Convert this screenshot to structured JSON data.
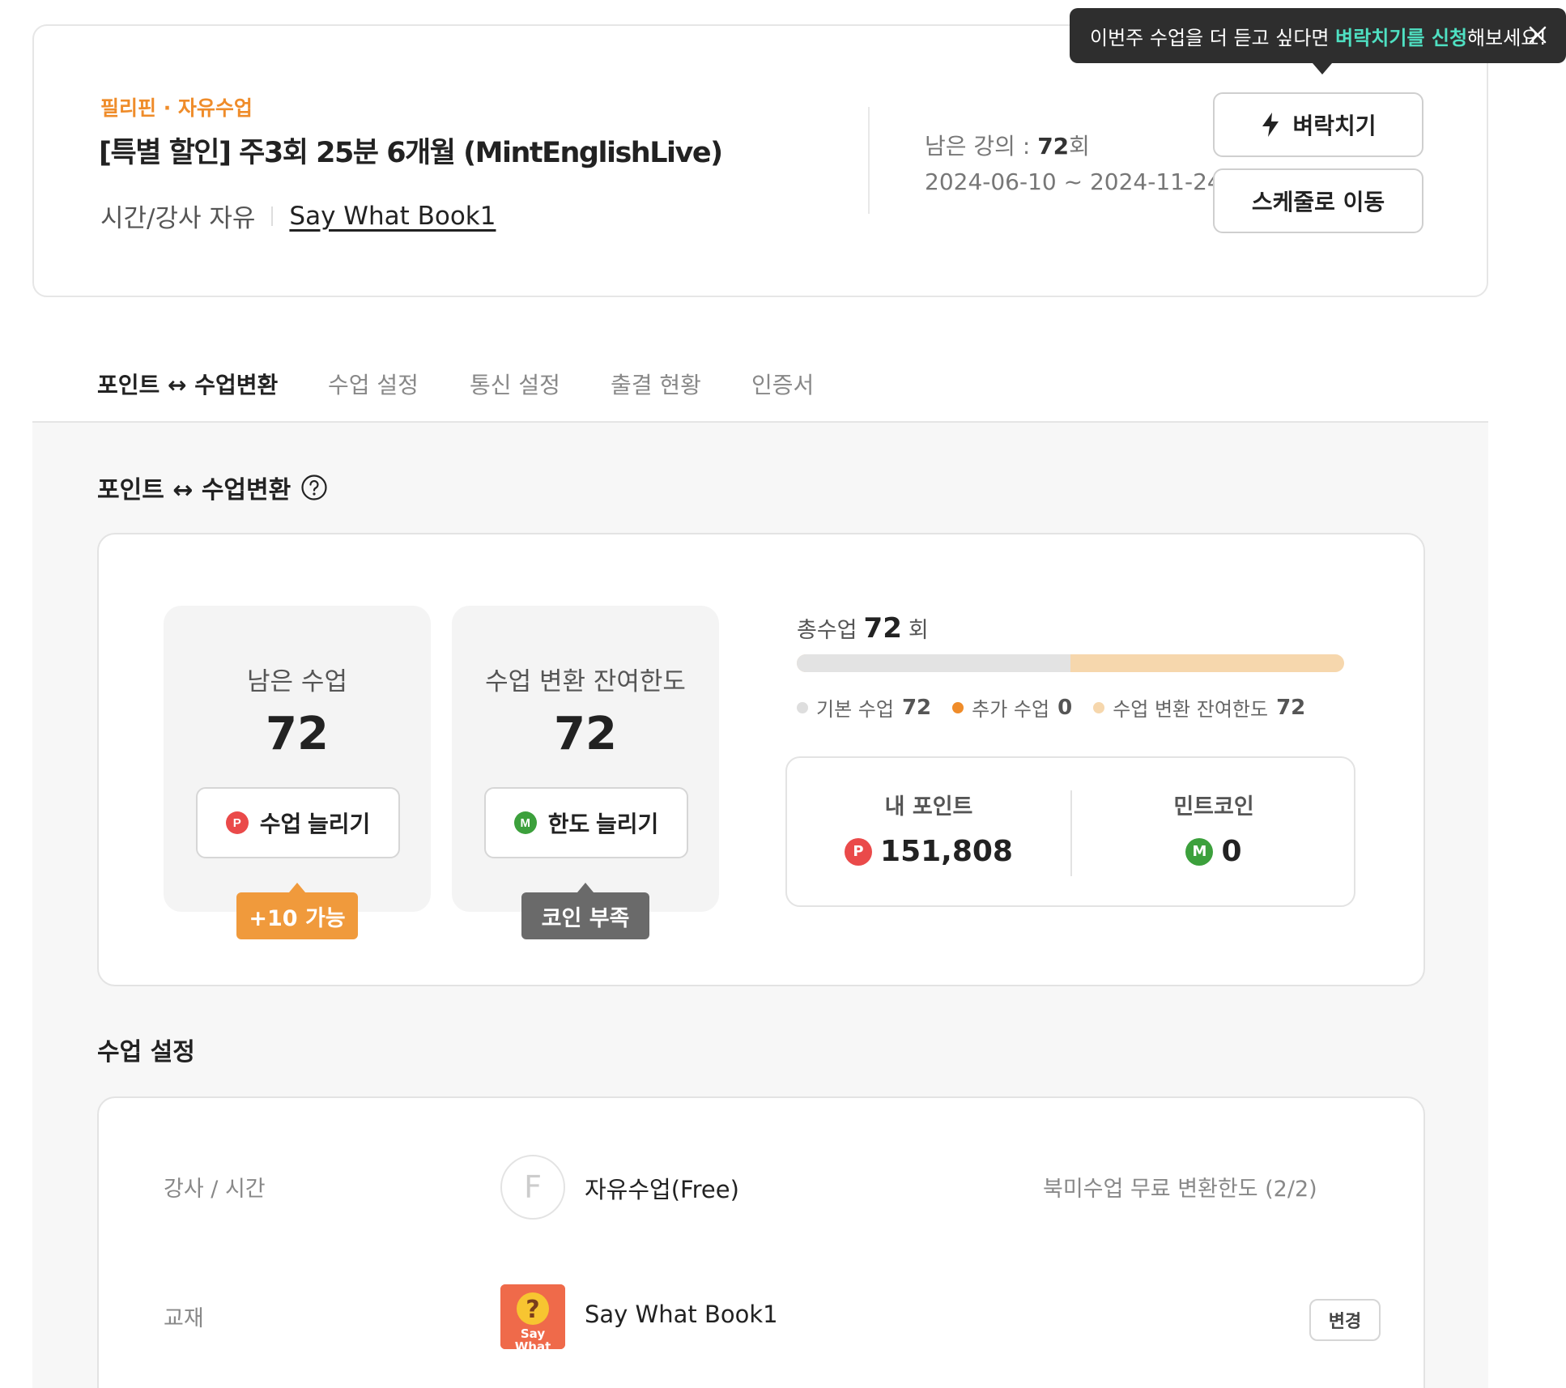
{
  "course": {
    "category": "필리핀 · 자유수업",
    "title": "[특별 할인] 주3회 25분 6개월 (MintEnglishLive)",
    "schedule_type": "시간/강사 자유",
    "book": "Say What Book1",
    "remaining_label": "남은 강의 : ",
    "remaining_count": "72",
    "remaining_unit": "회",
    "period": "2024-06-10 ~ 2024-11-24",
    "dawn_button": "벼락치기",
    "schedule_button": "스케줄로 이동"
  },
  "tooltip": {
    "prefix": "이번주 수업을 더 듣고 싶다면 ",
    "highlight": "벼락치기를 신청",
    "suffix": "해보세요!"
  },
  "tabs": [
    {
      "label": "포인트 ↔ 수업변환",
      "active": true
    },
    {
      "label": "수업 설정",
      "active": false
    },
    {
      "label": "통신 설정",
      "active": false
    },
    {
      "label": "출결 현황",
      "active": false
    },
    {
      "label": "인증서",
      "active": false
    }
  ],
  "conversion": {
    "section_title": "포인트 ↔ 수업변환",
    "remaining_label": "남은 수업",
    "remaining_value": "72",
    "add_class_button": "수업 늘리기",
    "add_class_badge": "+10 가능",
    "limit_label": "수업 변환 잔여한도",
    "limit_value": "72",
    "add_limit_button": "한도 늘리기",
    "add_limit_badge": "코인 부족",
    "total_label": "총수업",
    "total_value": "72",
    "total_unit": "회",
    "progress_base_fraction": 0.5,
    "legend": [
      {
        "label": "기본 수업",
        "value": "72",
        "color": "#dedede"
      },
      {
        "label": "추가 수업",
        "value": "0",
        "color": "#ef8c2a"
      },
      {
        "label": "수업 변환 잔여한도",
        "value": "72",
        "color": "#f6d7ad"
      }
    ],
    "my_points_label": "내 포인트",
    "my_points_value": "151,808",
    "mint_coin_label": "민트코인",
    "mint_coin_value": "0",
    "point_coin_letter": "P",
    "mint_coin_letter": "M"
  },
  "class_settings": {
    "section_title": "수업 설정",
    "teacher_label": "강사 / 시간",
    "teacher_initial": "F",
    "teacher_value": "자유수업(Free)",
    "teacher_note": "북미수업 무료 변환한도 (2/2)",
    "book_label": "교재",
    "book_value": "Say What Book1",
    "book_change_button": "변경"
  },
  "colors": {
    "accent_orange": "#ef8c2a",
    "tooltip_highlight": "#4fe0c2",
    "point_red": "#ea4a4a",
    "mint_green": "#3ca03c"
  }
}
